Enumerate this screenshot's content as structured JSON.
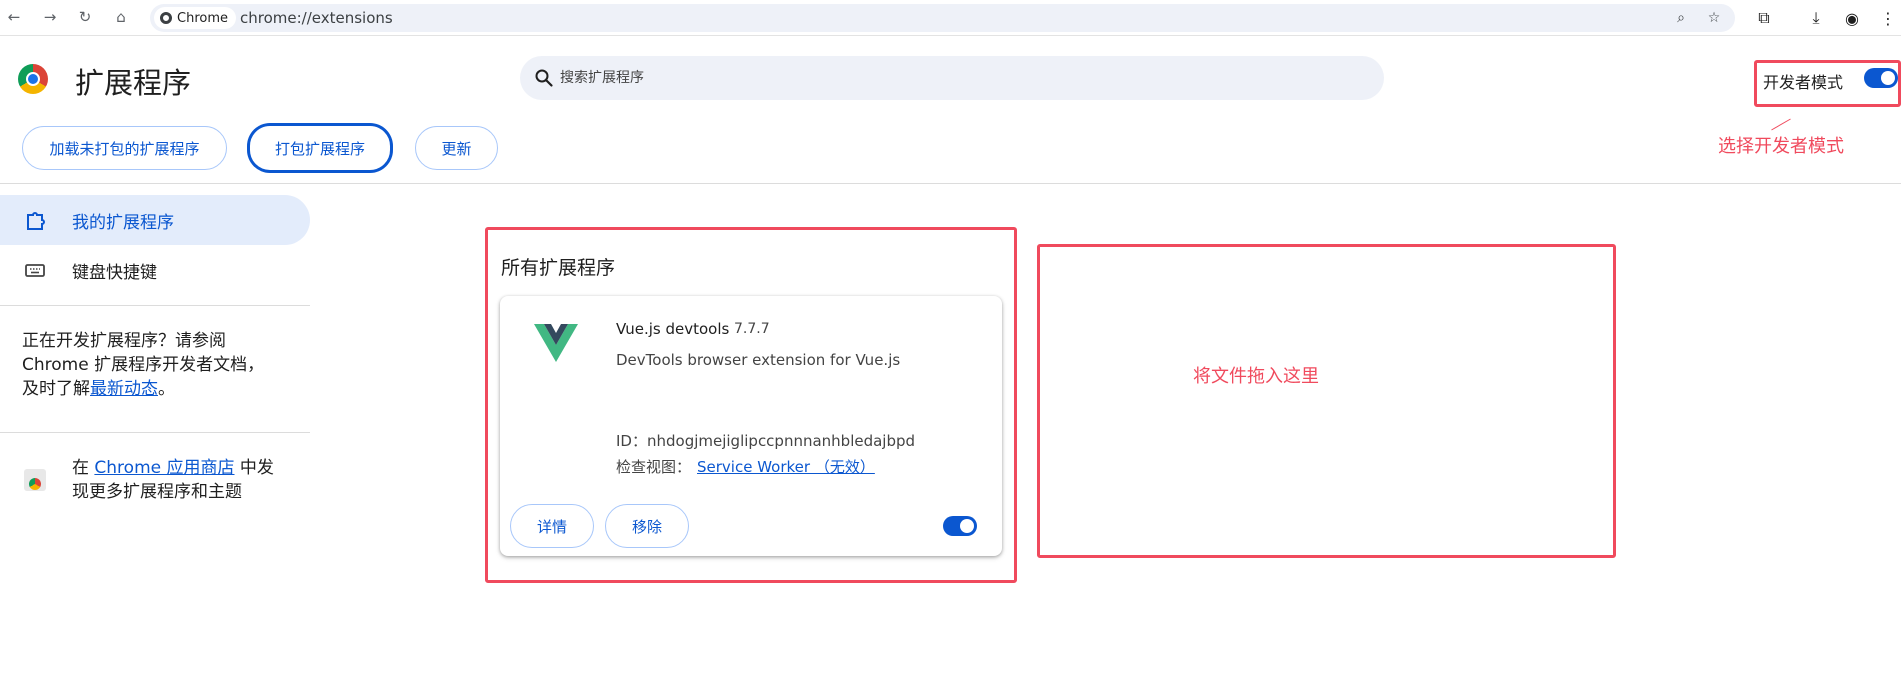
{
  "browser": {
    "chip_label": "Chrome",
    "url": "chrome://extensions"
  },
  "header": {
    "title": "扩展程序",
    "search_placeholder": "搜索扩展程序",
    "dev_mode_label": "开发者模式",
    "dev_mode_on": true
  },
  "toolbar": {
    "load_unpacked": "加载未打包的扩展程序",
    "pack": "打包扩展程序",
    "update": "更新"
  },
  "sidebar": {
    "items": [
      {
        "label": "我的扩展程序",
        "icon": "extension-icon",
        "active": true
      },
      {
        "label": "键盘快捷键",
        "icon": "keyboard-icon",
        "active": false
      }
    ],
    "dev_text_1": "正在开发扩展程序？请参阅",
    "dev_text_2": "Chrome 扩展程序开发者文档，",
    "dev_text_3": "及时了解",
    "dev_link": "最新动态",
    "dev_text_4": "。",
    "store_prefix": "在 ",
    "store_link": "Chrome 应用商店",
    "store_suffix": " 中发",
    "store_line2": "现更多扩展程序和主题"
  },
  "main": {
    "section_title": "所有扩展程序",
    "extension": {
      "name": "Vue.js devtools",
      "version": "7.7.7",
      "description": "DevTools browser extension for Vue.js",
      "id_label": "ID：",
      "id_value": "nhdogjmejiglipccpnnnanhbledajbpd",
      "views_label": "检查视图：",
      "views_link": "Service Worker （无效）",
      "details_button": "详情",
      "remove_button": "移除",
      "enabled": true
    }
  },
  "annotations": {
    "dev_mode_note": "选择开发者模式",
    "drop_note": "将文件拖入这里",
    "highlight_color": "#f04a5d"
  },
  "colors": {
    "accent": "#0b57d0",
    "sidebar_active": "#e3ecfb",
    "search_bg": "#eef1f8"
  }
}
